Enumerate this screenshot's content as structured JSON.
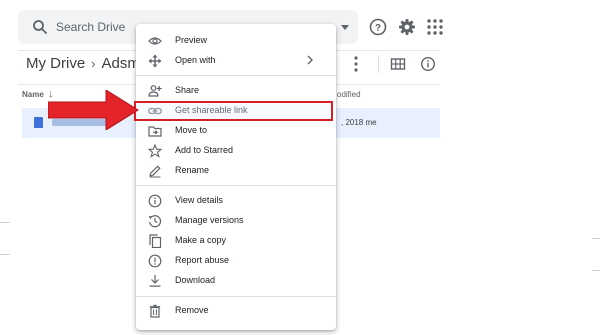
{
  "search": {
    "placeholder": "Search Drive",
    "icon": "search-icon"
  },
  "header_icons": [
    "help-icon",
    "settings-icon",
    "apps-grid-icon"
  ],
  "breadcrumb": {
    "root": "My Drive",
    "current": "Adsmas"
  },
  "toolbar_icons": [
    "more-vert-icon",
    "grid-view-icon",
    "info-icon"
  ],
  "file_list": {
    "columns": {
      "name": "Name",
      "modified": "odified"
    },
    "rows": [
      {
        "date": ", 2018 me"
      }
    ]
  },
  "context_menu": {
    "items": [
      {
        "id": "preview",
        "label": "Preview",
        "icon": "eye-icon"
      },
      {
        "id": "open-with",
        "label": "Open with",
        "icon": "move-arrows-icon",
        "submenu": true
      },
      {
        "id": "share",
        "label": "Share",
        "icon": "person-add-icon"
      },
      {
        "id": "get-shareable-link",
        "label": "Get shareable link",
        "icon": "link-icon",
        "highlighted": true
      },
      {
        "id": "move-to",
        "label": "Move to",
        "icon": "folder-move-icon"
      },
      {
        "id": "add-to-starred",
        "label": "Add to Starred",
        "icon": "star-icon"
      },
      {
        "id": "rename",
        "label": "Rename",
        "icon": "pencil-icon"
      },
      {
        "id": "view-details",
        "label": "View details",
        "icon": "info-icon"
      },
      {
        "id": "manage-versions",
        "label": "Manage versions",
        "icon": "history-icon"
      },
      {
        "id": "make-a-copy",
        "label": "Make a copy",
        "icon": "copy-icon"
      },
      {
        "id": "report-abuse",
        "label": "Report abuse",
        "icon": "alert-icon"
      },
      {
        "id": "download",
        "label": "Download",
        "icon": "download-icon"
      },
      {
        "id": "remove",
        "label": "Remove",
        "icon": "trash-icon"
      }
    ]
  },
  "colors": {
    "accent": "#d91f26",
    "arrow_fill": "#e3242b",
    "selection": "#e8f0fe",
    "search_bg": "#f1f3f4",
    "icon_gray": "#5f6368"
  }
}
